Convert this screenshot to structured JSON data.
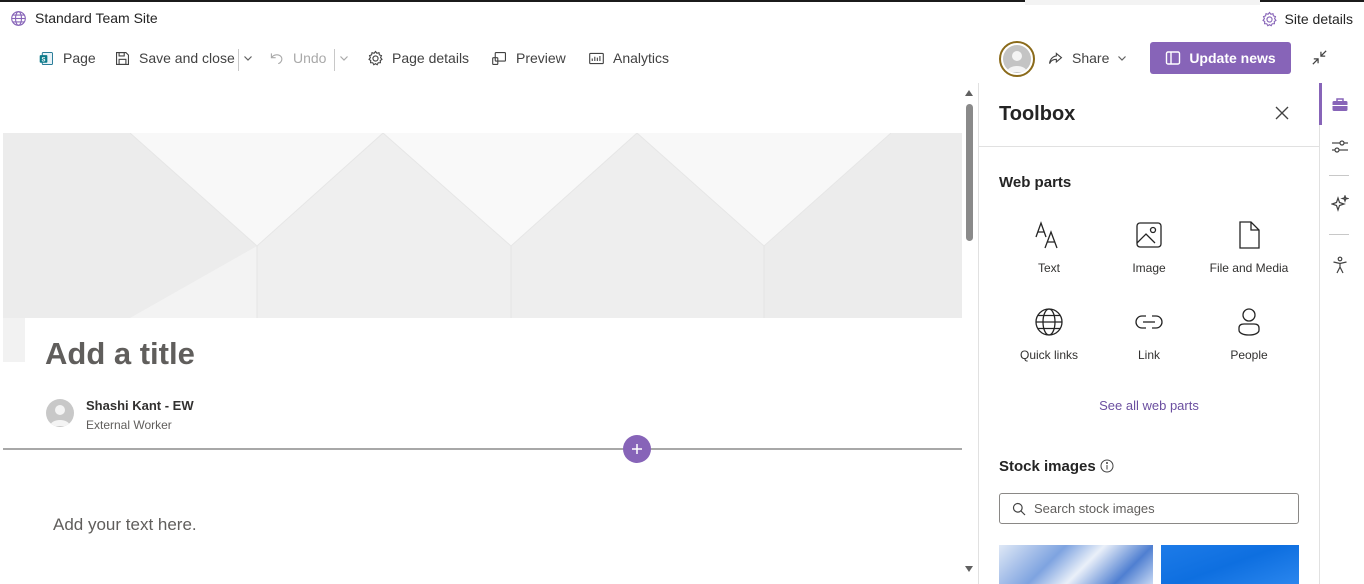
{
  "site": {
    "title": "Standard Team Site",
    "details_label": "Site details"
  },
  "commandbar": {
    "page_label": "Page",
    "save_close_label": "Save and close",
    "undo_label": "Undo",
    "page_details_label": "Page details",
    "preview_label": "Preview",
    "analytics_label": "Analytics",
    "share_label": "Share",
    "update_news_label": "Update news"
  },
  "page": {
    "title_placeholder": "Add a title",
    "author_name": "Shashi Kant - EW",
    "author_role": "External Worker",
    "text_placeholder": "Add your text here."
  },
  "toolbox": {
    "title": "Toolbox",
    "web_parts_heading": "Web parts",
    "web_parts": [
      {
        "label": "Text",
        "icon": "text-icon"
      },
      {
        "label": "Image",
        "icon": "image-icon"
      },
      {
        "label": "File and Media",
        "icon": "file-icon"
      },
      {
        "label": "Quick links",
        "icon": "globe-icon"
      },
      {
        "label": "Link",
        "icon": "link-icon"
      },
      {
        "label": "People",
        "icon": "person-icon"
      }
    ],
    "see_all_label": "See all web parts",
    "stock_heading": "Stock images",
    "search_placeholder": "Search stock images"
  },
  "colors": {
    "accent": "#8764b8",
    "link": "#6b4fa0"
  }
}
